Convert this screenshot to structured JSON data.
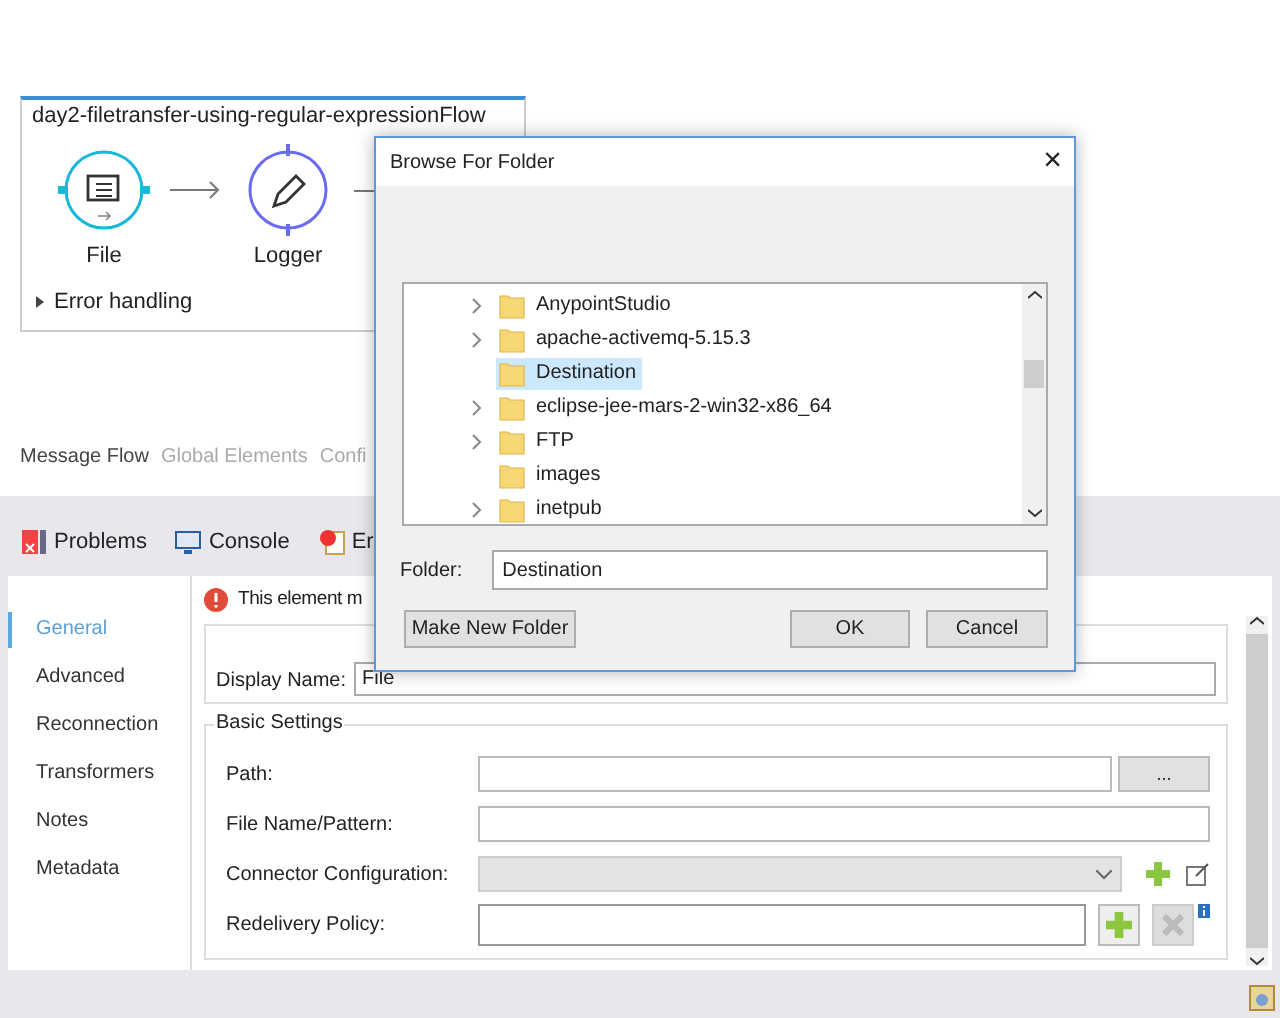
{
  "flow": {
    "title": "day2-filetransfer-using-regular-expressionFlow",
    "nodes": [
      {
        "label": "File",
        "kind": "file"
      },
      {
        "label": "Logger",
        "kind": "logger"
      }
    ],
    "error_handling": {
      "label": "Error handling",
      "expanded": false
    }
  },
  "editor_tabs": [
    {
      "label": "Message Flow",
      "selected": true
    },
    {
      "label": "Global Elements",
      "selected": false
    },
    {
      "label": "Confi",
      "selected": false
    }
  ],
  "view_tabs": [
    {
      "label": "Problems",
      "kind": "problems"
    },
    {
      "label": "Console",
      "kind": "console"
    },
    {
      "label": "Er",
      "kind": "error"
    }
  ],
  "sidebar": {
    "items": [
      {
        "label": "General",
        "selected": true
      },
      {
        "label": "Advanced",
        "selected": false
      },
      {
        "label": "Reconnection",
        "selected": false
      },
      {
        "label": "Transformers",
        "selected": false
      },
      {
        "label": "Notes",
        "selected": false
      },
      {
        "label": "Metadata",
        "selected": false
      }
    ]
  },
  "error_message": "This element m",
  "display_name": {
    "label": "Display Name:",
    "value": "File"
  },
  "basic_settings": {
    "title": "Basic Settings",
    "fields": [
      {
        "label": "Path:",
        "kind": "browse",
        "button": "..."
      },
      {
        "label": "File Name/Pattern:",
        "kind": "text"
      },
      {
        "label": "Connector Configuration:",
        "kind": "select"
      },
      {
        "label": "Redelivery Policy:",
        "kind": "policy"
      }
    ]
  },
  "dialog": {
    "title": "Browse For Folder",
    "close": "×",
    "tree": [
      {
        "label": "AnypointStudio",
        "has_children": true,
        "selected": false
      },
      {
        "label": "apache-activemq-5.15.3",
        "has_children": true,
        "selected": false
      },
      {
        "label": "Destination",
        "has_children": false,
        "selected": true
      },
      {
        "label": "eclipse-jee-mars-2-win32-x86_64",
        "has_children": true,
        "selected": false
      },
      {
        "label": "FTP",
        "has_children": true,
        "selected": false
      },
      {
        "label": "images",
        "has_children": false,
        "selected": false
      },
      {
        "label": "inetpub",
        "has_children": true,
        "selected": false
      }
    ],
    "folder_label": "Folder:",
    "folder_value": "Destination",
    "buttons": [
      {
        "label": "Make New Folder",
        "kind": "left"
      },
      {
        "label": "OK",
        "kind": "default"
      },
      {
        "label": "Cancel",
        "kind": "normal"
      }
    ]
  }
}
